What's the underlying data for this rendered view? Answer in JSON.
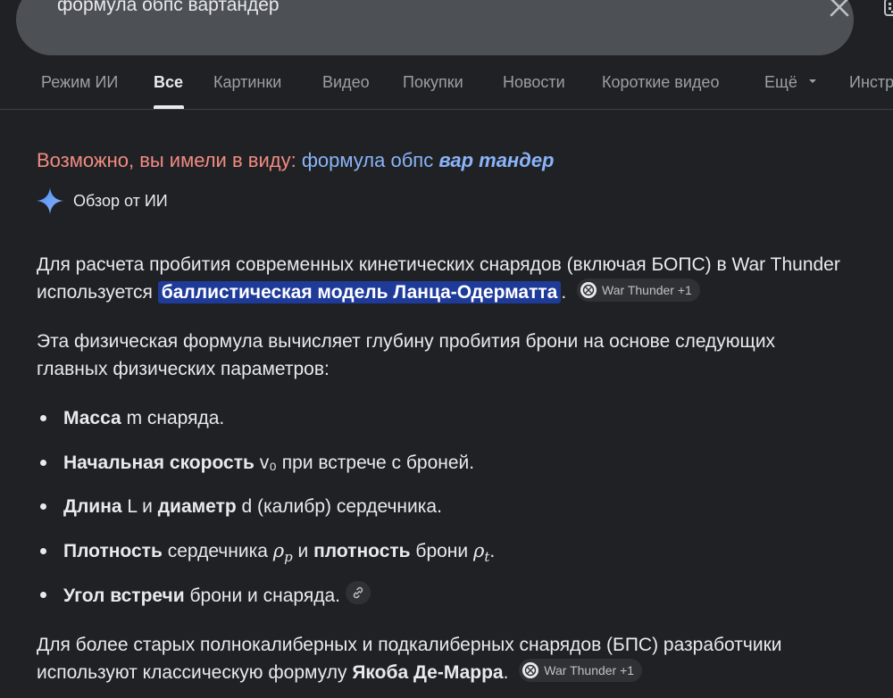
{
  "search": {
    "query": "формула обпс вартандер"
  },
  "tabs": [
    {
      "label": "Режим ИИ"
    },
    {
      "label": "Все"
    },
    {
      "label": "Картинки"
    },
    {
      "label": "Видео"
    },
    {
      "label": "Покупки"
    },
    {
      "label": "Новости"
    },
    {
      "label": "Короткие видео"
    },
    {
      "label": "Ещё"
    },
    {
      "label": "Инстр"
    }
  ],
  "did_you_mean": {
    "prefix": "Возможно, вы имели в виду:",
    "plain": "формула обпс",
    "bold": "вар тандер"
  },
  "ai_overview": {
    "title": "Обзор от ИИ",
    "para1": {
      "text": "Для расчета пробития современных кинетических снарядов (включая БОПС) в War Thunder используется",
      "highlight": "баллистическая модель Ланца-Одерматта",
      "end": ".",
      "source": "War Thunder +1"
    },
    "para2": "Эта физическая формула вычисляет глубину пробития брони на основе следующих главных физических параметров:",
    "bullets": [
      {
        "bold": "Масса",
        "rest": " m снаряда."
      },
      {
        "bold": "Начальная скорость",
        "rest": " v₀ при встрече с броней."
      },
      {
        "bold1": "Длина",
        "mid1": " L и ",
        "bold2": "диаметр",
        "rest": " d (калибр) сердечника."
      },
      {
        "bold1": "Плотность",
        "mid1": " сердечника ",
        "sym1": "ρ",
        "sub1": "p",
        "mid2": " и ",
        "bold2": "плотность",
        "mid3": " брони ",
        "sym2": "ρ",
        "sub2": "t",
        "end": "."
      },
      {
        "bold": "Угол встречи",
        "rest": " брони и снаряда."
      }
    ],
    "para3": {
      "text": "Для более старых полнокалиберных и подкалиберных снарядов (БПС) разработчики используют классическую формулу",
      "bold": "Якоба Де-Марра",
      "end": ".",
      "source": "War Thunder +1"
    }
  },
  "colors": {
    "background": "#202124",
    "highlight": "#1f3b9a",
    "link": "#8ab4f8",
    "spelling": "#f28b82"
  }
}
